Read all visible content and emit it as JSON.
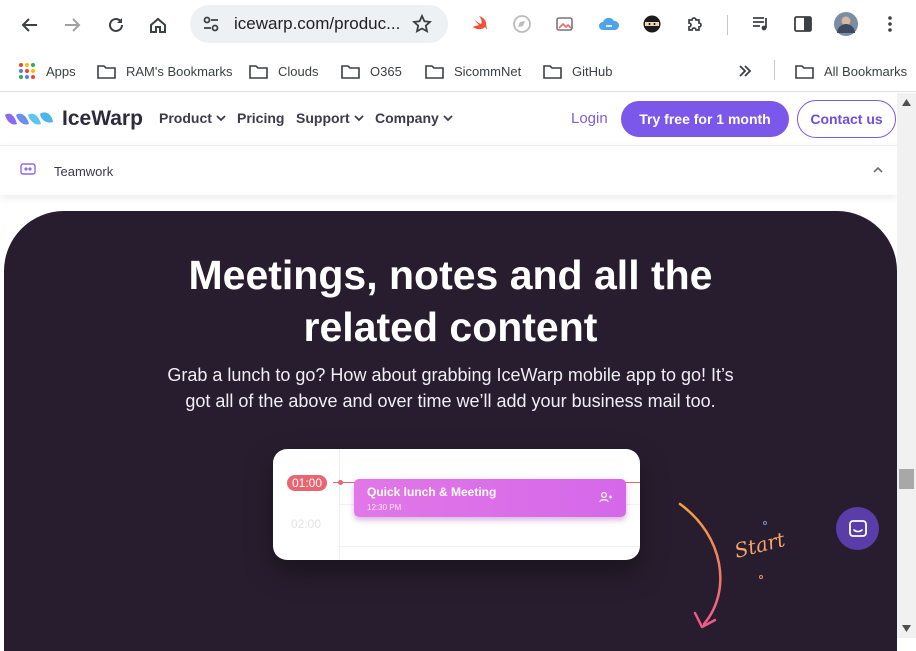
{
  "browser": {
    "url": "icewarp.com/produc...",
    "bookmarks": [
      {
        "label": "Apps",
        "icon": "apps-grid-icon"
      },
      {
        "label": "RAM's Bookmarks",
        "icon": "folder-icon"
      },
      {
        "label": "Clouds",
        "icon": "folder-icon"
      },
      {
        "label": "O365",
        "icon": "folder-icon"
      },
      {
        "label": "SicommNet",
        "icon": "folder-icon"
      },
      {
        "label": "GitHub",
        "icon": "folder-icon"
      }
    ],
    "all_bookmarks": "All Bookmarks"
  },
  "site": {
    "brand": "IceWarp",
    "nav": {
      "product": "Product",
      "pricing": "Pricing",
      "support": "Support",
      "company": "Company"
    },
    "login": "Login",
    "try_free": "Try free for 1 month",
    "contact": "Contact us",
    "subnav_label": "Teamwork"
  },
  "hero": {
    "title_line1": "Meetings, notes and all the",
    "title_line2": "related content",
    "subtitle_line1": "Grab a lunch to go? How about grabbing IceWarp mobile app to go! It’s",
    "subtitle_line2": "got all of the above and over time we’ll add your business mail too.",
    "card": {
      "time1": "01:00",
      "time2": "02:00",
      "event_title": "Quick lunch & Meeting",
      "event_time": "12:30 PM"
    },
    "start_label": "Start"
  },
  "colors": {
    "brand_purple": "#7b57ea",
    "hero_bg": "#281d2e",
    "event_pink": "#e277e8",
    "time_badge": "#eb6570"
  }
}
